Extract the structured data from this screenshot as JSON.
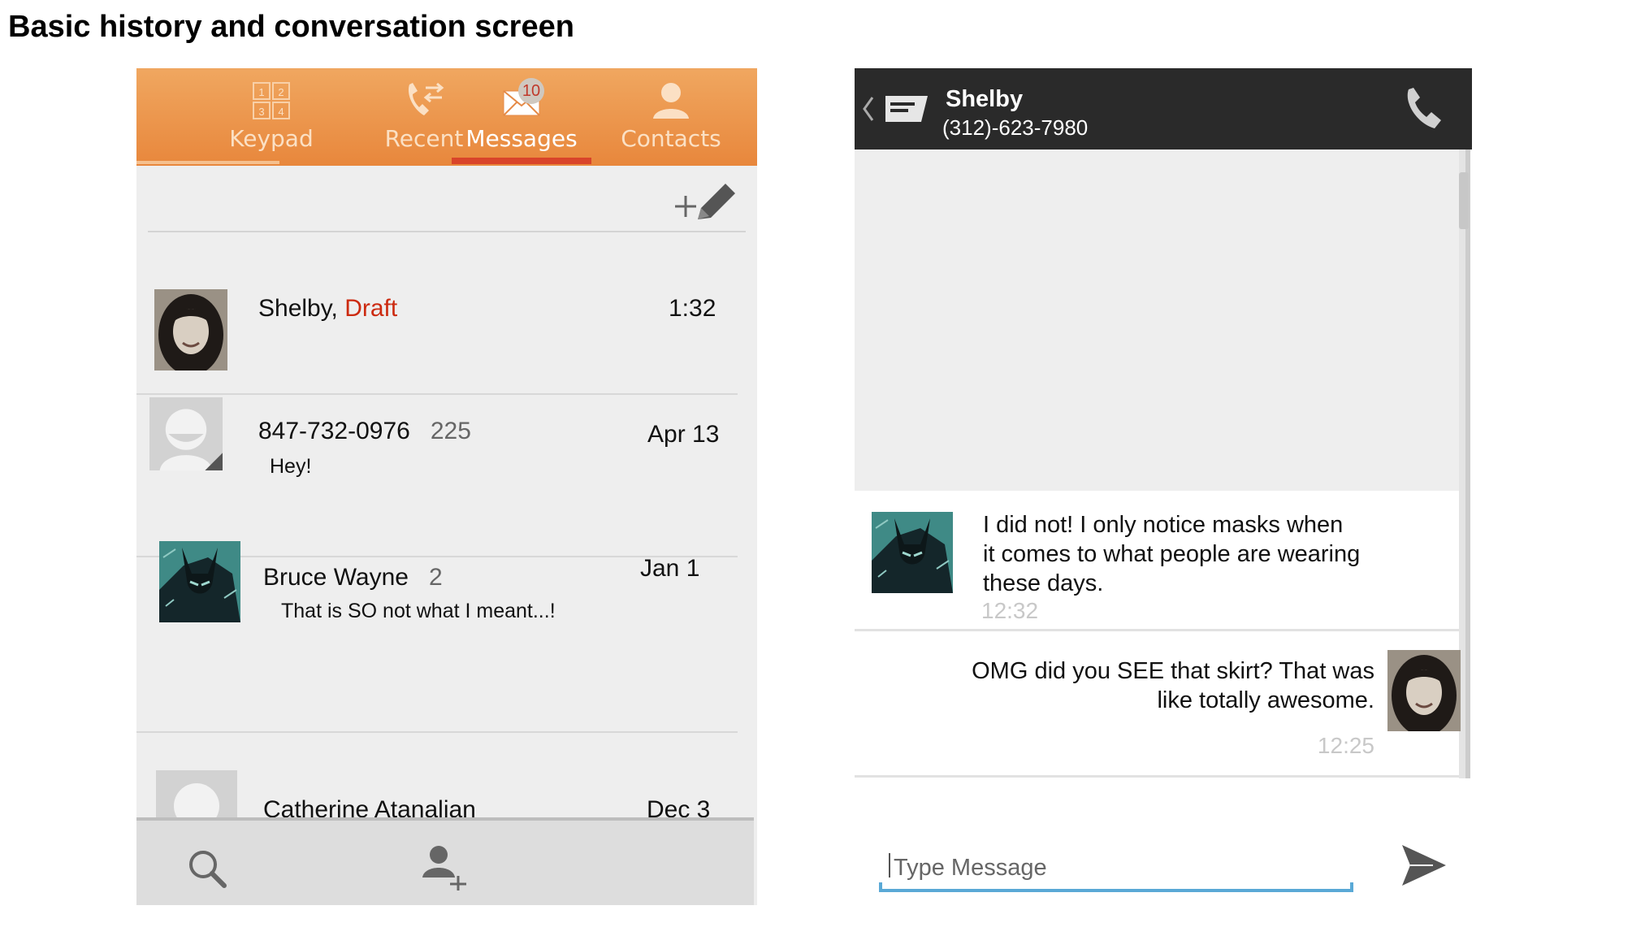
{
  "page": {
    "title": "Basic history and conversation screen"
  },
  "left_screen": {
    "tabs": [
      {
        "label": "Keypad",
        "icon": "keypad-icon",
        "active": false
      },
      {
        "label": "Recent",
        "icon": "recent-calls-icon",
        "active": false
      },
      {
        "label": "Messages",
        "icon": "envelope-icon",
        "active": true,
        "badge": "10"
      },
      {
        "label": "Contacts",
        "icon": "person-icon",
        "active": false
      }
    ],
    "keypad_digits": [
      "1",
      "2",
      "3",
      "4"
    ],
    "compose_icon": "compose-plus-pencil-icon",
    "conversations": [
      {
        "name": "Shelby,",
        "tag": "Draft",
        "count": "",
        "preview": "",
        "time": "1:32",
        "avatar": "photo-woman"
      },
      {
        "name": "847-732-0976",
        "tag": "",
        "count": "225",
        "preview": "Hey!",
        "time": "Apr 13",
        "avatar": "default-avatar"
      },
      {
        "name": "Bruce Wayne",
        "tag": "",
        "count": "2",
        "preview": "That is SO not what I meant...!",
        "time": "Jan 1",
        "avatar": "photo-batman"
      },
      {
        "name": "Catherine Atanalian",
        "tag": "",
        "count": "",
        "preview": "",
        "time": "Dec 3",
        "avatar": "default-avatar"
      }
    ],
    "bottom_bar": {
      "icons": [
        "search-icon",
        "add-contact-icon"
      ]
    }
  },
  "right_screen": {
    "header": {
      "name": "Shelby",
      "number": "(312)-623-7980",
      "icons": [
        "back-chevron-icon",
        "message-app-icon",
        "phone-icon"
      ]
    },
    "messages": [
      {
        "text_lines": [
          "I did not! I only notice masks when",
          "it comes to what people are wearing",
          "these days."
        ],
        "time": "12:32",
        "side": "incoming",
        "avatar": "photo-batman"
      },
      {
        "text_lines": [
          "OMG did you SEE that skirt? That was",
          "like totally awesome."
        ],
        "time": "12:25",
        "side": "outgoing",
        "avatar": "photo-woman"
      }
    ],
    "compose": {
      "placeholder": "Type Message",
      "send_icon": "send-arrow-icon"
    }
  },
  "colors": {
    "tab_bar_orange": "#e8873c",
    "active_tab_underline": "#d9442a",
    "draft_red": "#cc2a10",
    "header_dark": "#2a2a2a",
    "input_underline_blue": "#5aa9d6"
  }
}
